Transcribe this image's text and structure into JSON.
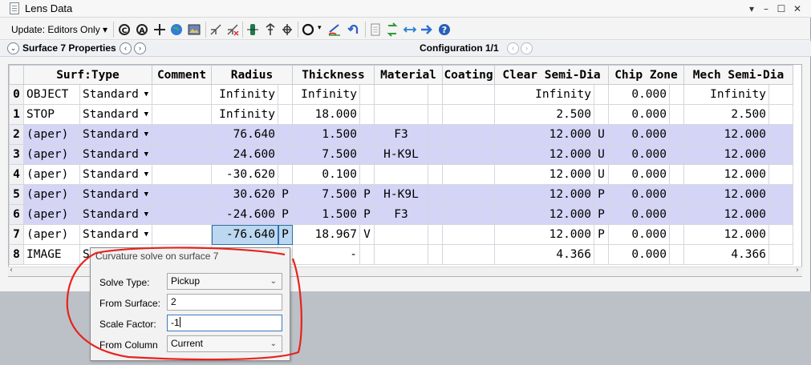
{
  "window": {
    "title": "Lens Data"
  },
  "toolbar": {
    "update_label": "Update: Editors Only ▾"
  },
  "propbar": {
    "surface_props": "Surface 7 Properties",
    "configuration": "Configuration 1/1"
  },
  "table": {
    "headers": [
      "Surf:Type",
      "Comment",
      "Radius",
      "",
      "Thickness",
      "",
      "Material",
      "",
      "Coating",
      "Clear Semi-Dia",
      "",
      "Chip Zone",
      "",
      "Mech Semi-Dia",
      ""
    ],
    "rows": [
      {
        "num": "0",
        "name": "OBJECT",
        "type": "Standard",
        "comment": "",
        "radius": "Infinity",
        "rs": "",
        "thick": "Infinity",
        "ts": "",
        "mat": "",
        "ms": "",
        "coat": "",
        "clear": "Infinity",
        "cs": "",
        "chip": "0.000",
        "chs": "",
        "mech": "Infinity",
        "mes": ""
      },
      {
        "num": "1",
        "name": "STOP",
        "type": "Standard",
        "comment": "",
        "radius": "Infinity",
        "rs": "",
        "thick": "18.000",
        "ts": "",
        "mat": "",
        "ms": "",
        "coat": "",
        "clear": "2.500",
        "cs": "",
        "chip": "0.000",
        "chs": "",
        "mech": "2.500",
        "mes": ""
      },
      {
        "num": "2",
        "name": "(aper)",
        "type": "Standard",
        "comment": "",
        "radius": "76.640",
        "rs": "",
        "thick": "1.500",
        "ts": "",
        "mat": "F3",
        "ms": "",
        "coat": "",
        "clear": "12.000",
        "cs": "U",
        "chip": "0.000",
        "chs": "",
        "mech": "12.000",
        "mes": ""
      },
      {
        "num": "3",
        "name": "(aper)",
        "type": "Standard",
        "comment": "",
        "radius": "24.600",
        "rs": "",
        "thick": "7.500",
        "ts": "",
        "mat": "H-K9L",
        "ms": "",
        "coat": "",
        "clear": "12.000",
        "cs": "U",
        "chip": "0.000",
        "chs": "",
        "mech": "12.000",
        "mes": ""
      },
      {
        "num": "4",
        "name": "(aper)",
        "type": "Standard",
        "comment": "",
        "radius": "-30.620",
        "rs": "",
        "thick": "0.100",
        "ts": "",
        "mat": "",
        "ms": "",
        "coat": "",
        "clear": "12.000",
        "cs": "U",
        "chip": "0.000",
        "chs": "",
        "mech": "12.000",
        "mes": ""
      },
      {
        "num": "5",
        "name": "(aper)",
        "type": "Standard",
        "comment": "",
        "radius": "30.620",
        "rs": "P",
        "thick": "7.500",
        "ts": "P",
        "mat": "H-K9L",
        "ms": "",
        "coat": "",
        "clear": "12.000",
        "cs": "P",
        "chip": "0.000",
        "chs": "",
        "mech": "12.000",
        "mes": ""
      },
      {
        "num": "6",
        "name": "(aper)",
        "type": "Standard",
        "comment": "",
        "radius": "-24.600",
        "rs": "P",
        "thick": "1.500",
        "ts": "P",
        "mat": "F3",
        "ms": "",
        "coat": "",
        "clear": "12.000",
        "cs": "P",
        "chip": "0.000",
        "chs": "",
        "mech": "12.000",
        "mes": ""
      },
      {
        "num": "7",
        "name": "(aper)",
        "type": "Standard",
        "comment": "",
        "radius": "-76.640",
        "rs": "P",
        "thick": "18.967",
        "ts": "V",
        "mat": "",
        "ms": "",
        "coat": "",
        "clear": "12.000",
        "cs": "P",
        "chip": "0.000",
        "chs": "",
        "mech": "12.000",
        "mes": ""
      },
      {
        "num": "8",
        "name": "IMAGE",
        "type": "St",
        "comment": "",
        "radius": "",
        "rs": "",
        "thick": "-",
        "ts": "",
        "mat": "",
        "ms": "",
        "coat": "",
        "clear": "4.366",
        "cs": "",
        "chip": "0.000",
        "chs": "",
        "mech": "4.366",
        "mes": ""
      }
    ]
  },
  "popup": {
    "title": "Curvature solve on surface 7",
    "solve_type_label": "Solve Type:",
    "solve_type_value": "Pickup",
    "from_surface_label": "From Surface:",
    "from_surface_value": "2",
    "scale_factor_label": "Scale Factor:",
    "scale_factor_value": "-1",
    "from_column_label": "From Column",
    "from_column_value": "Current"
  },
  "colors": {
    "selected_row": "#d4d4f6",
    "editing_cell": "#bcd7f0",
    "annotation": "#e8231c"
  }
}
